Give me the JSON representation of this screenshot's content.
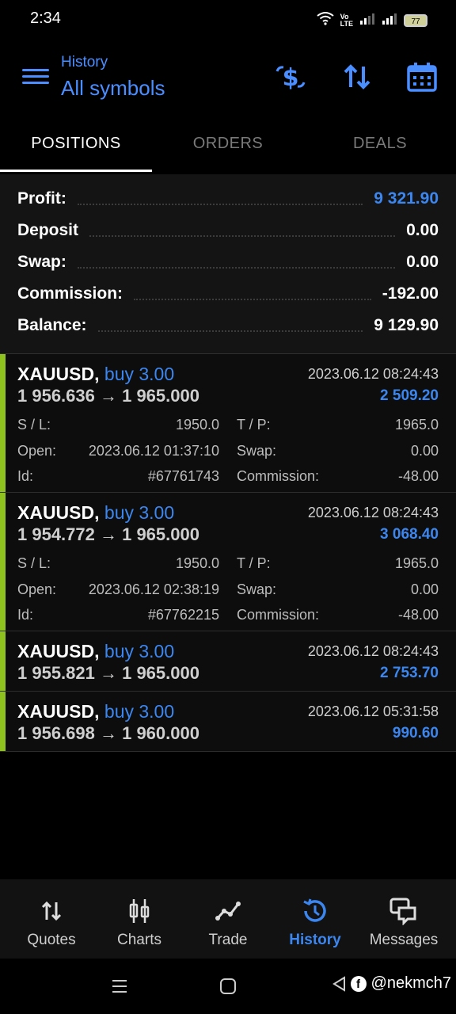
{
  "status": {
    "time": "2:34",
    "battery": "77"
  },
  "header": {
    "subtitle": "History",
    "title": "All symbols"
  },
  "tabs": [
    {
      "label": "POSITIONS"
    },
    {
      "label": "ORDERS"
    },
    {
      "label": "DEALS"
    }
  ],
  "summary": {
    "profit_label": "Profit:",
    "profit": "9 321.90",
    "deposit_label": "Deposit",
    "deposit": "0.00",
    "swap_label": "Swap:",
    "swap": "0.00",
    "commission_label": "Commission:",
    "commission": "-192.00",
    "balance_label": "Balance:",
    "balance": "9 129.90"
  },
  "positions": [
    {
      "symbol": "XAUUSD,",
      "side": "buy 3.00",
      "prices": "1 956.636 → 1 965.000",
      "time": "2023.06.12 08:24:43",
      "profit": "2 509.20",
      "sl_label": "S / L:",
      "sl": "1950.0",
      "tp_label": "T / P:",
      "tp": "1965.0",
      "open_label": "Open:",
      "open": "2023.06.12 01:37:10",
      "swap_label": "Swap:",
      "swap": "0.00",
      "id_label": "Id:",
      "id": "#67761743",
      "commission_label": "Commission:",
      "commission": "-48.00"
    },
    {
      "symbol": "XAUUSD,",
      "side": "buy 3.00",
      "prices": "1 954.772 → 1 965.000",
      "time": "2023.06.12 08:24:43",
      "profit": "3 068.40",
      "sl_label": "S / L:",
      "sl": "1950.0",
      "tp_label": "T / P:",
      "tp": "1965.0",
      "open_label": "Open:",
      "open": "2023.06.12 02:38:19",
      "swap_label": "Swap:",
      "swap": "0.00",
      "id_label": "Id:",
      "id": "#67762215",
      "commission_label": "Commission:",
      "commission": "-48.00"
    },
    {
      "symbol": "XAUUSD,",
      "side": "buy 3.00",
      "prices": "1 955.821 → 1 965.000",
      "time": "2023.06.12 08:24:43",
      "profit": "2 753.70"
    },
    {
      "symbol": "XAUUSD,",
      "side": "buy 3.00",
      "prices": "1 956.698 → 1 960.000",
      "time": "2023.06.12 05:31:58",
      "profit": "990.60"
    }
  ],
  "nav": [
    {
      "label": "Quotes",
      "icon": "quotes-icon"
    },
    {
      "label": "Charts",
      "icon": "charts-icon"
    },
    {
      "label": "Trade",
      "icon": "trade-icon"
    },
    {
      "label": "History",
      "icon": "history-icon"
    },
    {
      "label": "Messages",
      "icon": "messages-icon"
    }
  ],
  "watermark": "@nekmch7",
  "colors": {
    "accent": "#3c86f0",
    "buy_bar": "#8ec21f",
    "background": "#000000"
  }
}
